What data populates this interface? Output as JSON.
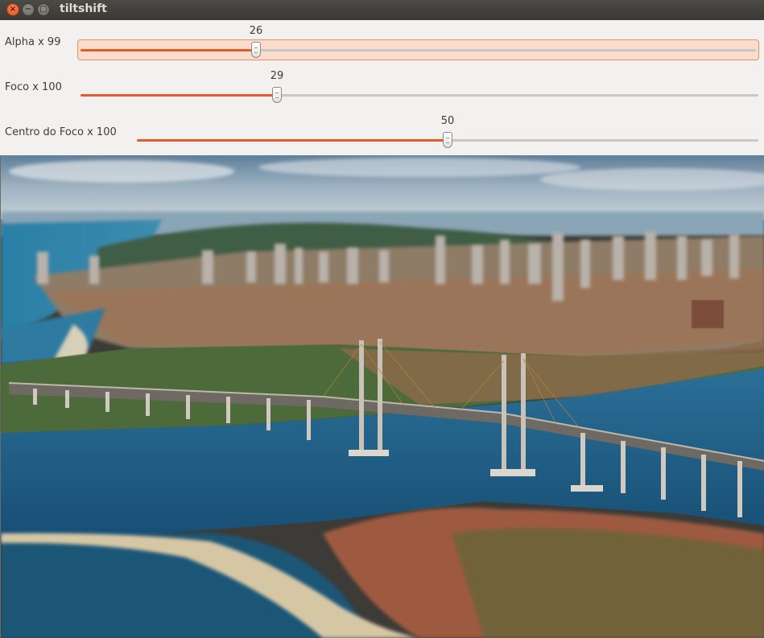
{
  "window": {
    "title": "tiltshift"
  },
  "sliders": [
    {
      "label": "Alpha x 99",
      "value": "26",
      "level_percent": 26
    },
    {
      "label": "Foco x 100",
      "value": "29",
      "level_percent": 29
    },
    {
      "label": "Centro do Foco x 100",
      "value": "50",
      "level_percent": 50
    }
  ],
  "colors": {
    "accent": "#e35d2c",
    "panel": "#f2f1f0",
    "titlebar": "#3c3b37"
  },
  "image": {
    "subject": "tilt-shift aerial photo of a city with a cable-stayed bridge over a river"
  }
}
